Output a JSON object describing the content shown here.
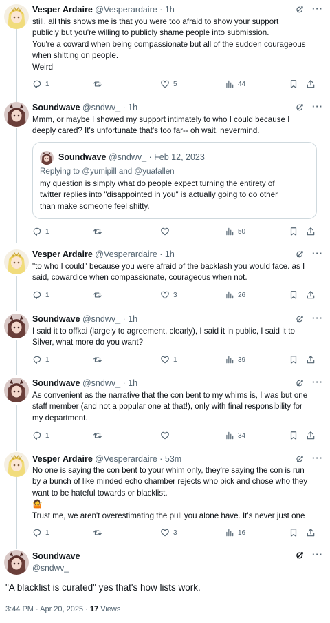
{
  "tweets": [
    {
      "name": "Vesper Ardaire",
      "handle": "@Vesperardaire",
      "time": "· 1h",
      "text": [
        "still, all this shows me is that you were too afraid to show your support",
        "publicly but you're willing to publicly shame people into submission.",
        "You're a coward when being compassionate but all of the sudden courageous",
        "when shitting on people.",
        "Weird"
      ],
      "replies": "1",
      "retweets": "",
      "likes": "5",
      "views": "44"
    },
    {
      "name": "Soundwave",
      "handle": "@sndwv_",
      "time": "· 1h",
      "text": [
        "Mmm, or maybe I showed my support intimately to who I could because I",
        "deeply cared? It's unfortunate that's too far-- oh wait, nevermind."
      ],
      "replies": "1",
      "retweets": "",
      "likes": "",
      "views": "50",
      "quote": {
        "name": "Soundwave",
        "handle": "@sndwv_",
        "time": "· Feb 12, 2023",
        "replying_to": "Replying to @yumipill and @yuafallen",
        "text": [
          "my question is simply what do people expect turning the entirety of",
          "twitter replies into \"disappointed in you\" is actually going to do other",
          "than make someone feel shitty."
        ]
      }
    },
    {
      "name": "Vesper Ardaire",
      "handle": "@Vesperardaire",
      "time": "· 1h",
      "text": [
        "\"to who I could\" because you were afraid of the backlash you would face. as I",
        "said, cowardice when compassionate, courageous when not."
      ],
      "replies": "1",
      "retweets": "",
      "likes": "3",
      "views": "26"
    },
    {
      "name": "Soundwave",
      "handle": "@sndwv_",
      "time": "· 1h",
      "text": [
        "I said it to offkai (largely to agreement, clearly), I said it in public, I said it to",
        "Silver, what more do you want?"
      ],
      "replies": "1",
      "retweets": "",
      "likes": "1",
      "views": "39"
    },
    {
      "name": "Soundwave",
      "handle": "@sndwv_",
      "time": "· 1h",
      "text": [
        "As convenient as the narrative that the con bent to my whims is, I was but one",
        "staff member (and not a popular one at that!), only with final responsibility for",
        "my department."
      ],
      "replies": "1",
      "retweets": "",
      "likes": "",
      "views": "34"
    },
    {
      "name": "Vesper Ardaire",
      "handle": "@Vesperardaire",
      "time": "· 53m",
      "text": [
        "No one is saying the con bent to your whim only, they're saying the con is run",
        "by a bunch of like minded echo chamber rejects who pick and chose who they",
        "want to be hateful towards or blacklist.",
        "🤷",
        "Trust me, we aren't overestimating the pull you alone have. It's never just one"
      ],
      "replies": "1",
      "retweets": "",
      "likes": "3",
      "views": "16"
    }
  ],
  "main_tweet": {
    "name": "Soundwave",
    "handle": "@sndwv_",
    "text": "\"A blacklist is curated\" yes that's how lists work.",
    "timestamp": "3:44 PM · Apr 20, 2025 · ",
    "views_count": "17",
    "views_label": " Views"
  },
  "icons": {
    "reply": "reply-icon",
    "retweet": "retweet-icon",
    "like": "heart-icon",
    "views": "bar-chart-icon",
    "bookmark": "bookmark-icon",
    "share": "share-icon",
    "grok": "grok-icon",
    "more": "more-icon"
  },
  "more_glyph": "···",
  "colors": {
    "text": "#0f1419",
    "secondary": "#536471",
    "border": "#cfd9de"
  }
}
